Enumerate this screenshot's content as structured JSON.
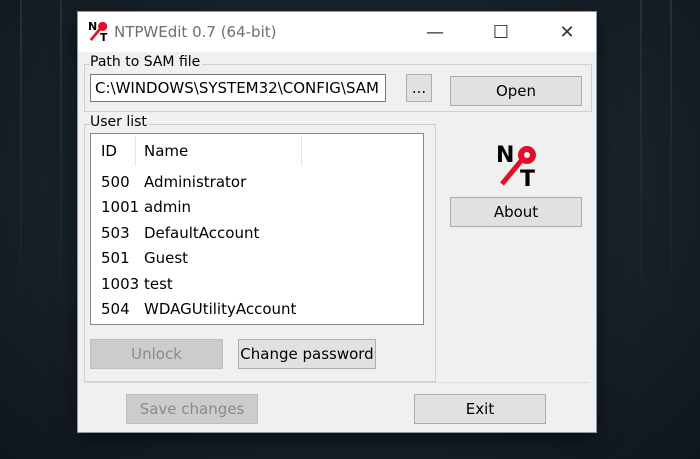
{
  "window": {
    "title": "NTPWEdit 0.7 (64-bit)",
    "controls": {
      "minimize": "—",
      "maximize": "☐",
      "close": "✕"
    }
  },
  "path_group": {
    "label": "Path to SAM file",
    "path_value": "C:\\WINDOWS\\SYSTEM32\\CONFIG\\SAM",
    "browse_label": "...",
    "open_label": "Open"
  },
  "user_list": {
    "label": "User list",
    "columns": [
      "ID",
      "Name"
    ],
    "rows": [
      {
        "id": "500",
        "name": "Administrator"
      },
      {
        "id": "1001",
        "name": "admin"
      },
      {
        "id": "503",
        "name": "DefaultAccount"
      },
      {
        "id": "501",
        "name": "Guest"
      },
      {
        "id": "1003",
        "name": "test"
      },
      {
        "id": "504",
        "name": "WDAGUtilityAccount"
      }
    ]
  },
  "actions": {
    "unlock_label": "Unlock",
    "change_password_label": "Change password",
    "about_label": "About",
    "save_label": "Save changes",
    "exit_label": "Exit"
  },
  "icons": {
    "app_logo": "nt-key-logo-icon",
    "logo_color": "#e0102a"
  }
}
